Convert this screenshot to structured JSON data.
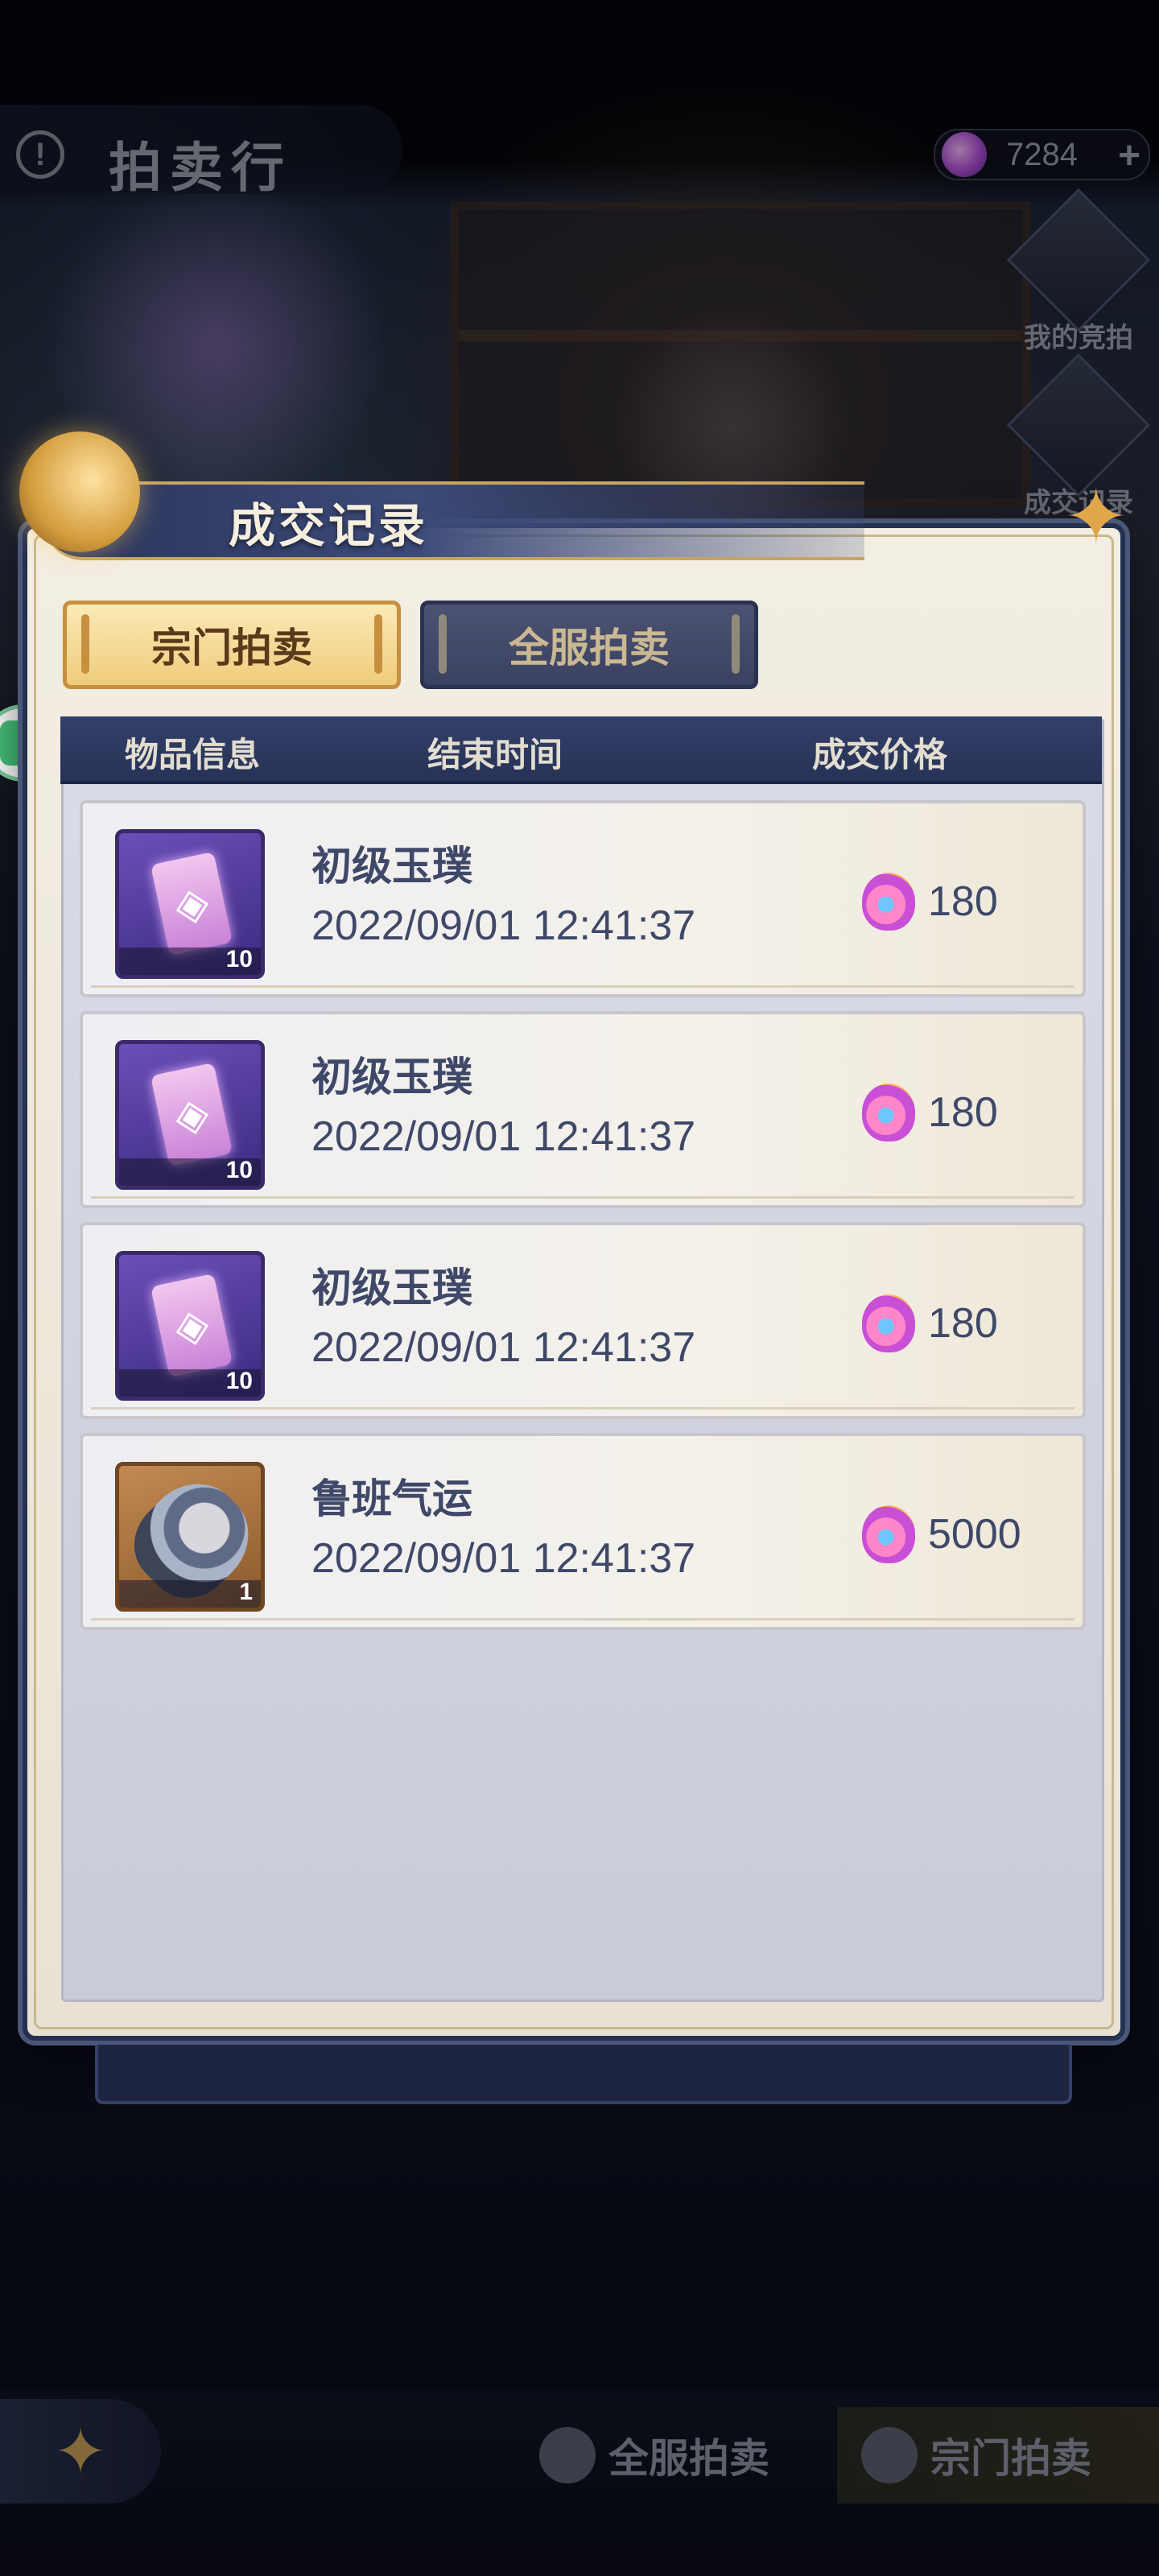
{
  "header": {
    "title": "拍卖行",
    "currency": {
      "value": "7284",
      "icon": "flame-gem-icon"
    }
  },
  "side_menu": [
    {
      "label": "我的竞拍"
    },
    {
      "label": "成交记录"
    }
  ],
  "bottom_nav": {
    "back_icon": "swallow-back-icon",
    "tabs": [
      {
        "label": "全服拍卖",
        "active": false
      },
      {
        "label": "宗门拍卖",
        "active": true
      }
    ]
  },
  "dialog": {
    "title": "成交记录",
    "tabs": [
      {
        "label": "宗门拍卖",
        "active": true
      },
      {
        "label": "全服拍卖",
        "active": false
      }
    ],
    "columns": [
      "物品信息",
      "结束时间",
      "成交价格"
    ],
    "rows": [
      {
        "icon": "jade-token-icon",
        "qty": "10",
        "name": "初级玉璞",
        "time": "2022/09/01  12:41:37",
        "price": "180"
      },
      {
        "icon": "jade-token-icon",
        "qty": "10",
        "name": "初级玉璞",
        "time": "2022/09/01  12:41:37",
        "price": "180"
      },
      {
        "icon": "jade-token-icon",
        "qty": "10",
        "name": "初级玉璞",
        "time": "2022/09/01  12:41:37",
        "price": "180"
      },
      {
        "icon": "hero-portrait-icon",
        "qty": "1",
        "name": "鲁班气运",
        "time": "2022/09/01  12:41:37",
        "price": "5000"
      }
    ]
  },
  "colors": {
    "panel_dark": "#263256",
    "tab_active": "#efcc7c",
    "text_primary": "#3f4868"
  }
}
